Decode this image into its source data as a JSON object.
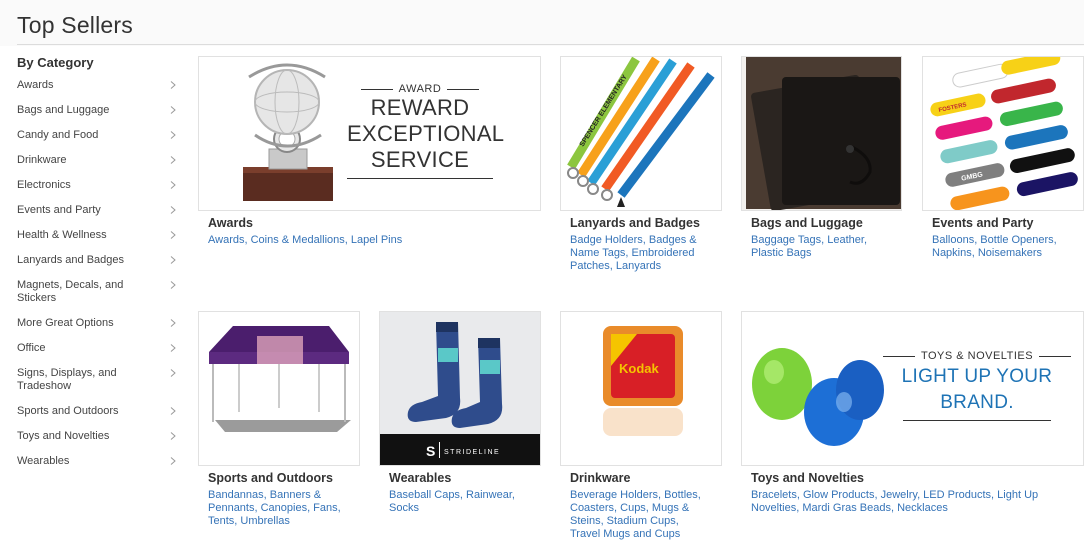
{
  "page": {
    "title": "Top Sellers"
  },
  "sidebar": {
    "heading": "By Category",
    "items": [
      {
        "label": "Awards"
      },
      {
        "label": "Bags and Luggage"
      },
      {
        "label": "Candy and Food"
      },
      {
        "label": "Drinkware"
      },
      {
        "label": "Electronics"
      },
      {
        "label": "Events and Party"
      },
      {
        "label": "Health & Wellness"
      },
      {
        "label": "Lanyards and Badges"
      },
      {
        "label": "Magnets, Decals, and Stickers"
      },
      {
        "label": "More Great Options"
      },
      {
        "label": "Office"
      },
      {
        "label": "Signs, Displays, and Tradeshow"
      },
      {
        "label": "Sports and Outdoors"
      },
      {
        "label": "Toys and Novelties"
      },
      {
        "label": "Wearables"
      }
    ]
  },
  "cards": {
    "awards": {
      "title": "Awards",
      "links": "Awards, Coins & Medallions, Lapel Pins",
      "banner_small": "AWARD",
      "banner_line1": "REWARD",
      "banner_line2": "EXCEPTIONAL",
      "banner_line3": "SERVICE"
    },
    "lanyards": {
      "title": "Lanyards and Badges",
      "links": "Badge Holders, Badges & Name Tags, Embroidered Patches, Lanyards",
      "strap_text_1": "SPENCER ELEMENTARY"
    },
    "bags": {
      "title": "Bags and Luggage",
      "links": "Baggage Tags, Leather, Plastic Bags"
    },
    "events": {
      "title": "Events and Party",
      "links": "Balloons, Bottle Openers, Napkins, Noisemakers",
      "opener_1": "GMBG",
      "opener_2": "FOSTERS"
    },
    "sports": {
      "title": "Sports and Outdoors",
      "links": "Bandannas, Banners & Pennants, Canopies, Fans, Tents, Umbrellas"
    },
    "wearables": {
      "title": "Wearables",
      "links": "Baseball Caps, Rainwear, Socks",
      "brand_letter": "S",
      "brand_name": "STRIDELINE"
    },
    "drinkware": {
      "title": "Drinkware",
      "links": "Beverage Holders, Bottles, Coasters, Cups, Mugs & Steins, Stadium Cups, Travel Mugs and Cups",
      "logo_text": "Kodak"
    },
    "toys": {
      "title": "Toys and Novelties",
      "links": "Bracelets, Glow Products, Jewelry, LED Products, Light Up Novelties, Mardi Gras Beads, Necklaces",
      "banner_small": "TOYS & NOVELTIES",
      "banner_line1": "LIGHT UP YOUR",
      "banner_line2": "BRAND."
    }
  }
}
